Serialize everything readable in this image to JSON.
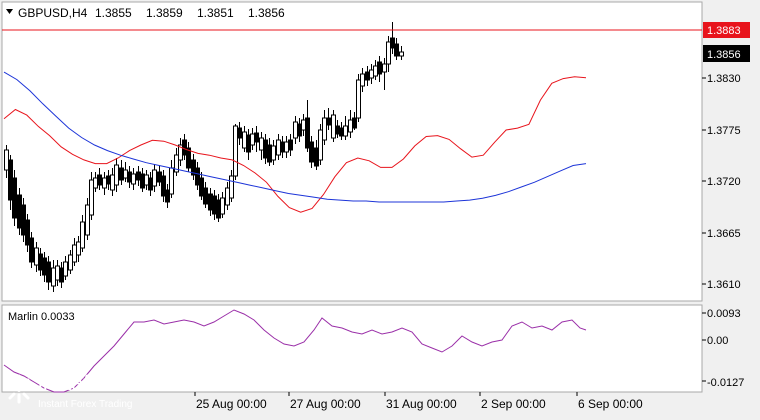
{
  "header": {
    "symbol": "GBPUSD,H4",
    "open": "1.3855",
    "high": "1.3859",
    "low": "1.3851",
    "close": "1.3856"
  },
  "price_scale": {
    "labels": [
      "1.3830",
      "1.3775",
      "1.3720",
      "1.3665",
      "1.3610"
    ],
    "red_line_label": "1.3883",
    "current_label": "1.3856"
  },
  "indicator": {
    "label": "Marlin 0.0033",
    "scale_labels": [
      "0.0093",
      "0.00",
      "-0.0127"
    ]
  },
  "time_axis": {
    "labels": [
      "25 Aug 00:00",
      "27 Aug 00:00",
      "31 Aug 00:00",
      "2 Sep 00:00",
      "6 Sep 00:00"
    ]
  },
  "watermark": {
    "name": "instaforex",
    "tagline": "Instant Forex Trading"
  },
  "colors": {
    "background": "#ffffff",
    "frame": "#f0f0f0",
    "bull": "#ffffff",
    "bear": "#000000",
    "ma_fast": "#e8141c",
    "ma_slow": "#1c34d8",
    "marlin": "#9a2fa8",
    "red_level": "#e8141c",
    "current_badge": "#000000"
  },
  "chart_data": {
    "type": "candlestick",
    "y_range": [
      1.3585,
      1.3905
    ],
    "ma_fast": [
      1.378,
      1.379,
      1.3784,
      1.3772,
      1.3762,
      1.375,
      1.3742,
      1.3736,
      1.3732,
      1.3732,
      1.3738,
      1.3746,
      1.3752,
      1.3757,
      1.3756,
      1.3752,
      1.3747,
      1.3743,
      1.3741,
      1.3738,
      1.3736,
      1.373,
      1.3722,
      1.3712,
      1.3697,
      1.3685,
      1.368,
      1.3684,
      1.3699,
      1.3718,
      1.3733,
      1.3738,
      1.3735,
      1.3728,
      1.3728,
      1.3737,
      1.3751,
      1.3761,
      1.3762,
      1.3758,
      1.3748,
      1.3739,
      1.3741,
      1.3755,
      1.3768,
      1.377,
      1.3774,
      1.38,
      1.3818,
      1.3823,
      1.3825,
      1.3824
    ],
    "ma_slow": [
      1.383,
      1.3822,
      1.381,
      1.3796,
      1.3783,
      1.377,
      1.376,
      1.3752,
      1.3746,
      1.3741,
      1.3737,
      1.3733,
      1.373,
      1.3727,
      1.3724,
      1.3721,
      1.3718,
      1.3715,
      1.3712,
      1.3709,
      1.3706,
      1.3703,
      1.37,
      1.3698,
      1.3696,
      1.3694,
      1.3693,
      1.3692,
      1.3692,
      1.3691,
      1.3691,
      1.3691,
      1.3691,
      1.3691,
      1.3691,
      1.3692,
      1.3693,
      1.3695,
      1.3698,
      1.3702,
      1.3707,
      1.3712,
      1.3718,
      1.3724,
      1.373,
      1.3732
    ]
  }
}
